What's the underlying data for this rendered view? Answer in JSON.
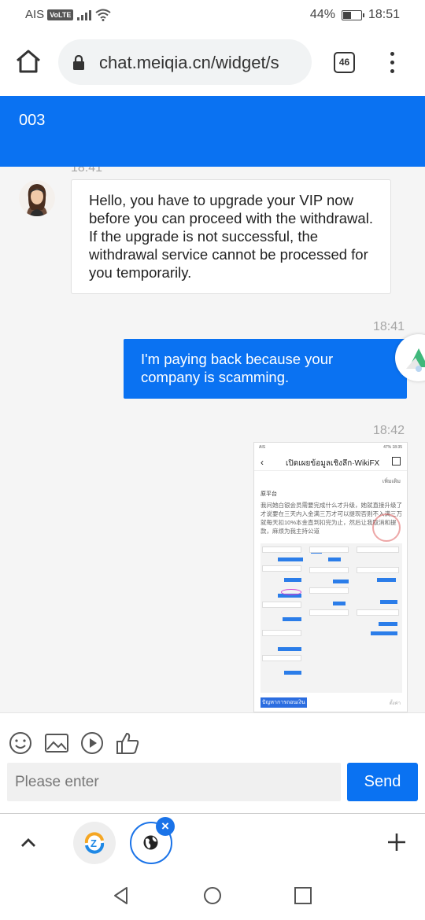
{
  "status_bar": {
    "carrier": "AIS",
    "volte": "VoLTE",
    "battery_text": "44%",
    "battery_level": 0.44,
    "time": "18:51"
  },
  "browser": {
    "url": "chat.meiqia.cn/widget/s",
    "tab_count": "46"
  },
  "chat": {
    "title": "003",
    "accent_color": "#0a72f2",
    "messages": [
      {
        "timestamp": "18:41",
        "direction": "incoming",
        "text": "Hello, you have to upgrade your VIP now before you can proceed with the withdrawal. If the upgrade is not successful, the withdrawal service cannot be processed for you temporarily."
      },
      {
        "timestamp": "18:41",
        "direction": "outgoing",
        "text": "I'm paying back because your company is scamming."
      },
      {
        "timestamp": "18:42",
        "direction": "outgoing",
        "type": "image",
        "image": {
          "status_left": "AIS",
          "status_right": "47% 18:35",
          "title": "เปิดเผยข้อมูลเชิงลึก·WikiFX",
          "more": "เพิ่มเติม",
          "section": "原平台",
          "paragraph": "我问她白银会员需要完成什么才升级，她就直接升级了才说要在三天内入金满三万才可以提现否则不入满三万就每天扣10%本金直到扣完为止，然后让我取消和提款，麻烦为我主持公道",
          "footer": "ปัญหาการถอนเงิน",
          "footer_right": "ตั้งค่า"
        }
      }
    ]
  },
  "composer": {
    "placeholder": "Please enter",
    "send_label": "Send"
  }
}
